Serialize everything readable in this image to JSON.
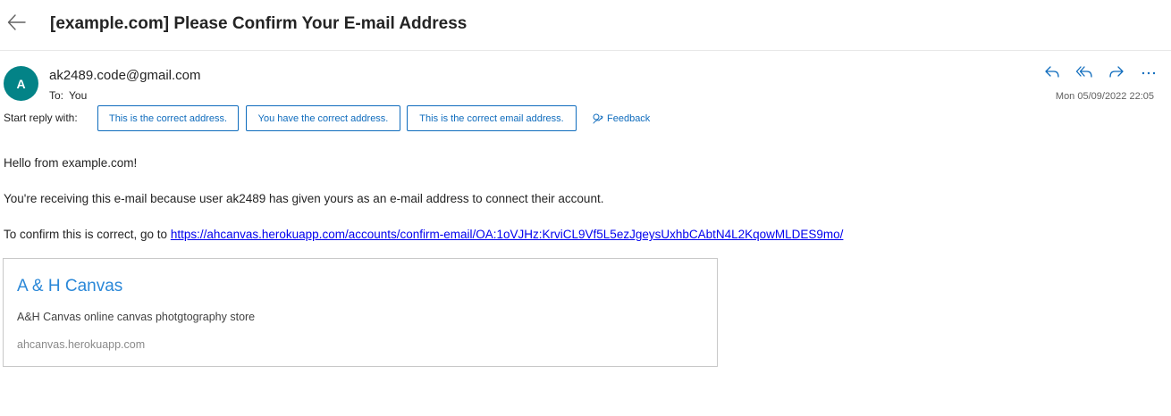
{
  "header": {
    "back_icon": "arrow-left-icon",
    "subject": "[example.com] Please Confirm Your E-mail Address"
  },
  "message": {
    "avatar_initial": "A",
    "avatar_color": "#038387",
    "sender": "ak2489.code@gmail.com",
    "to_label": "To:",
    "to_value": "You",
    "date": "Mon 05/09/2022 22:05",
    "actions": [
      {
        "name": "reply",
        "icon": "reply-icon"
      },
      {
        "name": "reply-all",
        "icon": "reply-all-icon"
      },
      {
        "name": "forward",
        "icon": "forward-icon"
      },
      {
        "name": "more",
        "icon": "more-icon"
      }
    ]
  },
  "suggested_replies": {
    "label": "Start reply with:",
    "items": [
      "This is the correct address.",
      "You have the correct address.",
      "This is the correct email address."
    ],
    "feedback_label": "Feedback",
    "feedback_icon": "feedback-icon"
  },
  "body": {
    "greeting": "Hello from example.com!",
    "paragraph": "You're receiving this e-mail because user ak2489 has given yours as an e-mail address to connect their account.",
    "confirm_prefix": "To confirm this is correct, go to",
    "confirm_link": "https://ahcanvas.herokuapp.com/accounts/confirm-email/OA:1oVJHz:KrviCL9Vf5L5ezJgeysUxhbCAbtN4L2KqowMLDES9mo/"
  },
  "link_preview": {
    "title": "A & H Canvas",
    "description": "A&H Canvas online canvas photgtography store",
    "domain": "ahcanvas.herokuapp.com"
  },
  "colors": {
    "accent": "#0f6cbd",
    "link": "#0000ee",
    "preview_title": "#2b88d8"
  }
}
